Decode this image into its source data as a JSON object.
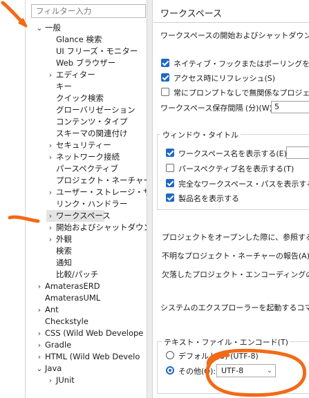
{
  "filter": {
    "placeholder": "フィルター入力"
  },
  "tree": {
    "general": "一般",
    "glance": "Glance 検索",
    "ui_freeze": "UI フリーズ・モニター",
    "web_browser": "Web ブラウザー",
    "editors": "エディター",
    "keys": "キー",
    "quick_search": "クイック検索",
    "globalization": "グローバリゼーション",
    "content_types": "コンテンツ・タイプ",
    "schema_assoc": "スキーマの関連付け",
    "security": "セキュリティー",
    "network": "ネットワーク接続",
    "perspectives": "パースペクティブ",
    "project_natures": "プロジェクト・ネーチャー",
    "user_storage": "ユーザー・ストレージ・サービ",
    "link_handlers": "リンク・ハンドラー",
    "workspace": "ワークスペース",
    "startup_shutdown": "開始およびシャットダウン",
    "appearance": "外観",
    "search": "検索",
    "notifications": "通知",
    "compare_patch": "比較/パッチ",
    "amateras_erd": "AmaterasERD",
    "amateras_uml": "AmaterasUML",
    "ant": "Ant",
    "checkstyle": "Checkstyle",
    "css": "CSS (Wild Web Develope",
    "gradle": "Gradle",
    "html": "HTML (Wild Web Develo",
    "java": "Java",
    "junit": "JUnit"
  },
  "page": {
    "title": "ワークスペース",
    "intro": "ワークスペースの開始およびシャットダウン設定",
    "native_hooks": "ネイティブ・フックまたはポーリングを使用し",
    "refresh_on_access": "アクセス時にリフレッシュ(S)",
    "always_close_unrelated": "常にプロンプトなしで無関係なプロジェクト",
    "save_interval_label": "ワークスペース保存間隔 (分)(W):",
    "save_interval_value": "5",
    "window_title_group": "ウィンドウ・タイトル",
    "show_workspace_name": "ワークスペース名を表示する(E):",
    "show_perspective_name": "パースペクティブ名を表示する(T)",
    "show_full_path": "完全なワークスペース・パスを表示する(F",
    "show_product_name": "製品名を表示する",
    "open_referenced": "プロジェクトをオープンした際に、参照するプロ",
    "unknown_nature": "不明なプロジェクト・ネーチャーの報告(A):",
    "missing_encoding": "欠落したプロジェクト・エンコーディングの報告",
    "explorer_command": "システムのエクスプローラーを起動するコマンド(",
    "encoding_group": "テキスト・ファイル・エンコード(T)",
    "default_option": "デフォルト(U) (UTF-8)",
    "other_option": "その他(O):",
    "encoding_value": "UTF-8"
  },
  "colors": {
    "accent": "#1f68c4",
    "annotation": "#f26a16"
  }
}
